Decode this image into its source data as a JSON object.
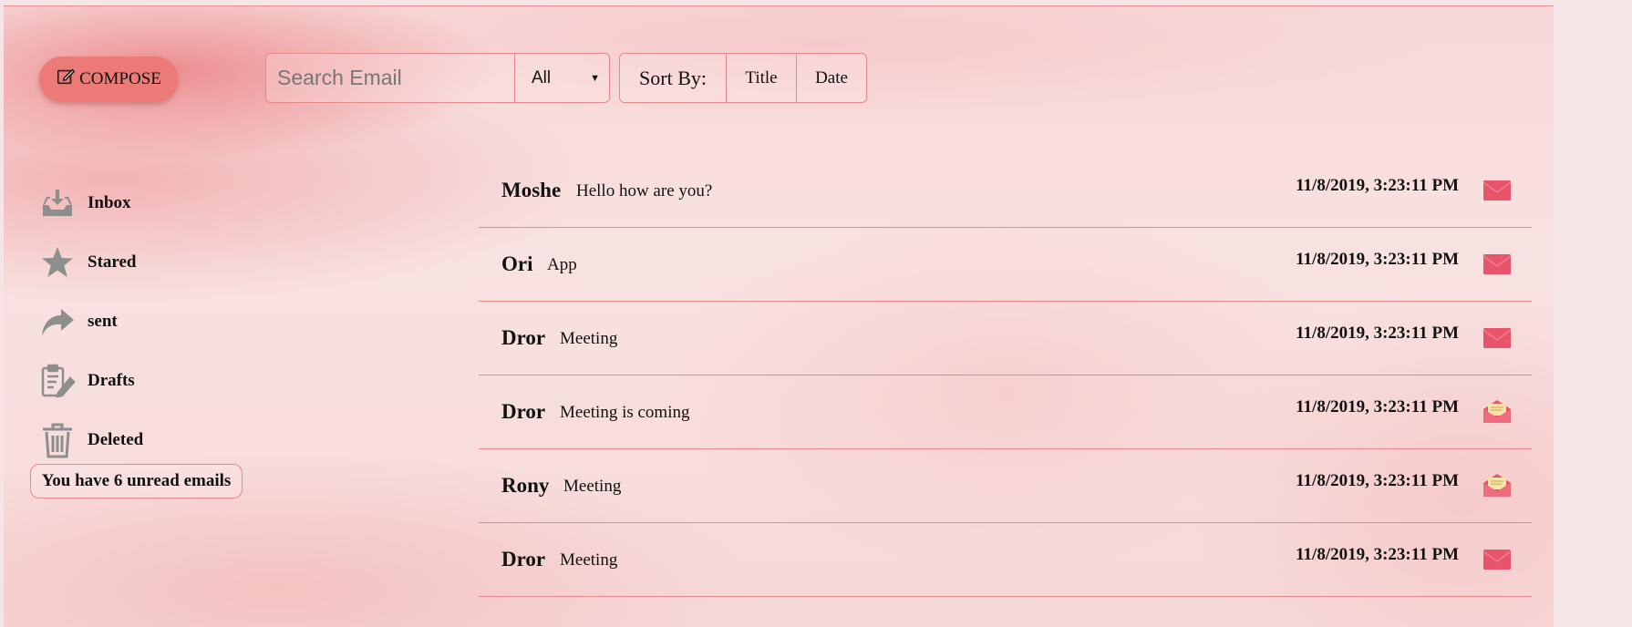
{
  "toolbar": {
    "compose_label": "COMPOSE",
    "search_placeholder": "Search Email",
    "filter_selected": "All",
    "sort_label": "Sort By:",
    "sort_title": "Title",
    "sort_date": "Date"
  },
  "sidebar": {
    "items": [
      {
        "label": "Inbox",
        "icon": "inbox-icon"
      },
      {
        "label": "Stared",
        "icon": "star-icon"
      },
      {
        "label": "sent",
        "icon": "forward-arrow-icon"
      },
      {
        "label": "Drafts",
        "icon": "clipboard-pencil-icon"
      },
      {
        "label": "Deleted",
        "icon": "trash-icon"
      }
    ],
    "unread_text": "You have 6 unread emails"
  },
  "emails": [
    {
      "sender": "Moshe",
      "subject": "Hello how are you?",
      "date": "11/8/2019, 3:23:11 PM",
      "status": "unread"
    },
    {
      "sender": "Ori",
      "subject": "App",
      "date": "11/8/2019, 3:23:11 PM",
      "status": "unread"
    },
    {
      "sender": "Dror",
      "subject": "Meeting",
      "date": "11/8/2019, 3:23:11 PM",
      "status": "unread"
    },
    {
      "sender": "Dror",
      "subject": "Meeting is coming",
      "date": "11/8/2019, 3:23:11 PM",
      "status": "read"
    },
    {
      "sender": "Rony",
      "subject": "Meeting",
      "date": "11/8/2019, 3:23:11 PM",
      "status": "read"
    },
    {
      "sender": "Dror",
      "subject": "Meeting",
      "date": "11/8/2019, 3:23:11 PM",
      "status": "unread"
    }
  ],
  "colors": {
    "accent": "#ec7b78",
    "border": "#e7898b",
    "envelope": "#e8546a"
  }
}
